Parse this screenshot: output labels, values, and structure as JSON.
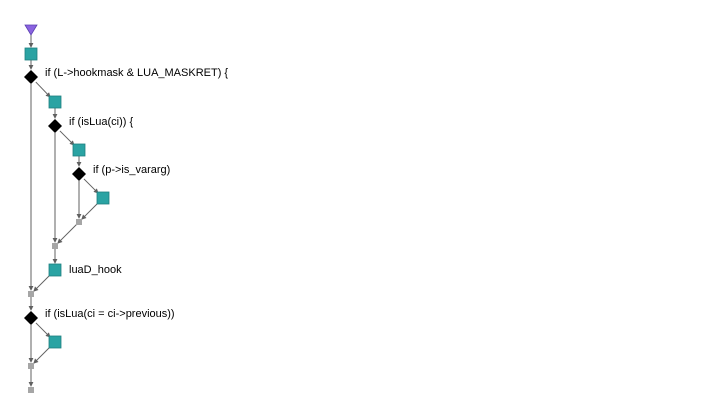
{
  "colors": {
    "background": "#ffffff",
    "edge": "#606060",
    "process_node": "#2aa3a3",
    "process_node_border": "#1f7f7f",
    "decision_node": "#000000",
    "merge_node": "#a6a6a6",
    "start_node": "#8a63e0"
  },
  "nodes": [
    {
      "id": "start",
      "kind": "start",
      "icon": "triangle-down-icon"
    },
    {
      "id": "n1",
      "kind": "process",
      "icon": "square-icon"
    },
    {
      "id": "d1",
      "kind": "decision",
      "icon": "diamond-icon",
      "label": "if (L->hookmask & LUA_MASKRET) {"
    },
    {
      "id": "n2",
      "kind": "process",
      "icon": "square-icon"
    },
    {
      "id": "d2",
      "kind": "decision",
      "icon": "diamond-icon",
      "label": "if (isLua(ci)) {"
    },
    {
      "id": "n3",
      "kind": "process",
      "icon": "square-icon"
    },
    {
      "id": "d3",
      "kind": "decision",
      "icon": "diamond-icon",
      "label": "if (p->is_vararg)"
    },
    {
      "id": "n4",
      "kind": "process",
      "icon": "square-icon"
    },
    {
      "id": "m3",
      "kind": "merge",
      "icon": "small-square-icon"
    },
    {
      "id": "m2",
      "kind": "merge",
      "icon": "small-square-icon"
    },
    {
      "id": "n5",
      "kind": "process",
      "icon": "square-icon",
      "label": "luaD_hook"
    },
    {
      "id": "m1",
      "kind": "merge",
      "icon": "small-square-icon"
    },
    {
      "id": "d4",
      "kind": "decision",
      "icon": "diamond-icon",
      "label": "if (isLua(ci = ci->previous))"
    },
    {
      "id": "n6",
      "kind": "process",
      "icon": "square-icon"
    },
    {
      "id": "m4",
      "kind": "merge",
      "icon": "small-square-icon"
    },
    {
      "id": "end",
      "kind": "merge",
      "icon": "small-square-icon"
    }
  ],
  "edges": [
    [
      "start",
      "n1"
    ],
    [
      "n1",
      "d1"
    ],
    [
      "d1",
      "n2"
    ],
    [
      "n2",
      "d2"
    ],
    [
      "d2",
      "n3"
    ],
    [
      "n3",
      "d3"
    ],
    [
      "d3",
      "n4"
    ],
    [
      "d3",
      "m3"
    ],
    [
      "n4",
      "m3"
    ],
    [
      "m3",
      "m2"
    ],
    [
      "d2",
      "m2"
    ],
    [
      "m2",
      "n5"
    ],
    [
      "n5",
      "m1"
    ],
    [
      "d1",
      "m1"
    ],
    [
      "m1",
      "d4"
    ],
    [
      "d4",
      "n6"
    ],
    [
      "d4",
      "m4"
    ],
    [
      "n6",
      "m4"
    ],
    [
      "m4",
      "end"
    ]
  ]
}
